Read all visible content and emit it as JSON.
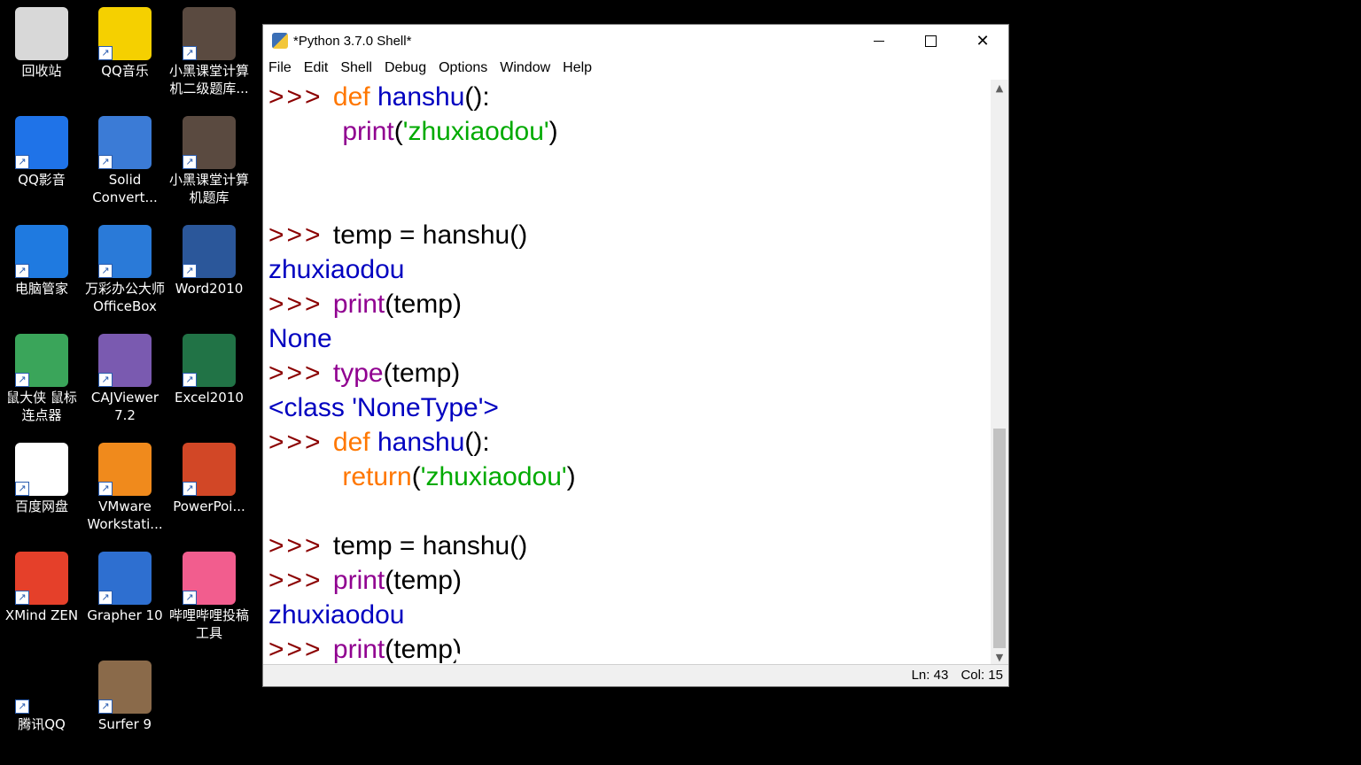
{
  "desktop": {
    "icons": [
      {
        "label": "回收站",
        "icon": "recycle-bin-icon",
        "color": "#d8d8d8"
      },
      {
        "label": "QQ音乐",
        "icon": "qq-music-icon",
        "color": "#f5d000"
      },
      {
        "label": "小黑课堂计算\n机二级题库...",
        "icon": "xiaohei-avatar-icon",
        "color": "#5a4a40"
      },
      {
        "label": "QQ影音",
        "icon": "qq-player-icon",
        "color": "#1f73e8"
      },
      {
        "label": "Solid\nConvert...",
        "icon": "solid-converter-icon",
        "color": "#3b7bd6"
      },
      {
        "label": "小黑课堂计算\n机题库",
        "icon": "xiaohei-avatar-icon",
        "color": "#5a4a40"
      },
      {
        "label": "电脑管家",
        "icon": "pc-manager-icon",
        "color": "#1f7ae0"
      },
      {
        "label": "万彩办公大师\nOfficeBox",
        "icon": "officebox-icon",
        "color": "#2a7ad8"
      },
      {
        "label": "Word2010",
        "icon": "word-icon",
        "color": "#2b579a"
      },
      {
        "label": "鼠大侠 鼠标\n连点器",
        "icon": "mouse-clicker-icon",
        "color": "#3aa55a"
      },
      {
        "label": "CAJViewer\n7.2",
        "icon": "cajviewer-icon",
        "color": "#7a5ab0"
      },
      {
        "label": "Excel2010",
        "icon": "excel-icon",
        "color": "#217346"
      },
      {
        "label": "百度网盘",
        "icon": "baidu-netdisk-icon",
        "color": "#ffffff"
      },
      {
        "label": "VMware\nWorkstati...",
        "icon": "vmware-icon",
        "color": "#f08a1c"
      },
      {
        "label": "PowerPoi...",
        "icon": "powerpoint-icon",
        "color": "#d24726"
      },
      {
        "label": "XMind ZEN",
        "icon": "xmind-icon",
        "color": "#e5402a"
      },
      {
        "label": "Grapher 10",
        "icon": "grapher-icon",
        "color": "#2e6fd0"
      },
      {
        "label": "哔哩哔哩投稿\n工具",
        "icon": "bilibili-icon",
        "color": "#f25d8e"
      },
      {
        "label": "腾讯QQ",
        "icon": "qq-penguin-icon",
        "color": "#000000"
      },
      {
        "label": "Surfer 9",
        "icon": "surfer-icon",
        "color": "#8a6a4a"
      }
    ]
  },
  "window": {
    "title": "*Python 3.7.0 Shell*",
    "menu": [
      "File",
      "Edit",
      "Shell",
      "Debug",
      "Options",
      "Window",
      "Help"
    ],
    "status_line": "Ln: 43",
    "status_col": "Col: 15"
  },
  "shell_lines": [
    [
      {
        "t": ">>> ",
        "c": "prompt"
      },
      {
        "t": "def ",
        "c": "kw"
      },
      {
        "t": "hanshu",
        "c": "fn"
      },
      {
        "t": "():",
        "c": "plain"
      }
    ],
    [
      {
        "t": "          ",
        "c": "plain"
      },
      {
        "t": "print",
        "c": "bi"
      },
      {
        "t": "(",
        "c": "plain"
      },
      {
        "t": "'zhuxiaodou'",
        "c": "str"
      },
      {
        "t": ")",
        "c": "plain"
      }
    ],
    [],
    [],
    [
      {
        "t": ">>> ",
        "c": "prompt"
      },
      {
        "t": "temp = hanshu()",
        "c": "plain"
      }
    ],
    [
      {
        "t": "zhuxiaodou",
        "c": "out"
      }
    ],
    [
      {
        "t": ">>> ",
        "c": "prompt"
      },
      {
        "t": "print",
        "c": "bi"
      },
      {
        "t": "(temp)",
        "c": "plain"
      }
    ],
    [
      {
        "t": "None",
        "c": "out"
      }
    ],
    [
      {
        "t": ">>> ",
        "c": "prompt"
      },
      {
        "t": "type",
        "c": "bi"
      },
      {
        "t": "(temp)",
        "c": "plain"
      }
    ],
    [
      {
        "t": "<class 'NoneType'>",
        "c": "out"
      }
    ],
    [
      {
        "t": ">>> ",
        "c": "prompt"
      },
      {
        "t": "def ",
        "c": "kw"
      },
      {
        "t": "hanshu",
        "c": "fn"
      },
      {
        "t": "():",
        "c": "plain"
      }
    ],
    [
      {
        "t": "          ",
        "c": "plain"
      },
      {
        "t": "return",
        "c": "kw"
      },
      {
        "t": "(",
        "c": "plain"
      },
      {
        "t": "'zhuxiaodou'",
        "c": "str"
      },
      {
        "t": ")",
        "c": "plain"
      }
    ],
    [],
    [
      {
        "t": ">>> ",
        "c": "prompt"
      },
      {
        "t": "temp = hanshu()",
        "c": "plain"
      }
    ],
    [
      {
        "t": ">>> ",
        "c": "prompt"
      },
      {
        "t": "print",
        "c": "bi"
      },
      {
        "t": "(temp)",
        "c": "plain"
      }
    ],
    [
      {
        "t": "zhuxiaodou",
        "c": "out"
      }
    ],
    [
      {
        "t": ">>> ",
        "c": "prompt"
      },
      {
        "t": "print",
        "c": "bi"
      },
      {
        "t": "(temp)",
        "c": "plain"
      }
    ]
  ]
}
